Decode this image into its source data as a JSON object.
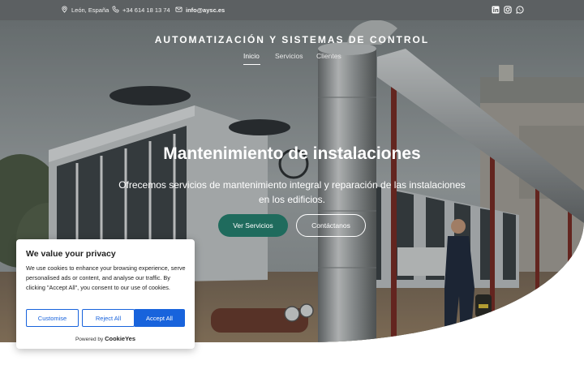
{
  "topbar": {
    "location": "León, España",
    "phone": "+34 614 18 13 74",
    "email": "info@aysc.es",
    "social": [
      "linkedin-icon",
      "instagram-icon",
      "whatsapp-icon"
    ]
  },
  "header": {
    "brand": "AUTOMATIZACIÓN Y SISTEMAS DE CONTROL",
    "nav": [
      {
        "label": "Inicio",
        "active": true
      },
      {
        "label": "Servicios",
        "active": false
      },
      {
        "label": "Clientes",
        "active": false
      }
    ]
  },
  "hero": {
    "title": "Mantenimiento de instalaciones",
    "subtitle": "Ofrecemos servicios de mantenimiento integral y reparación de las instalaciones en los edificios.",
    "primary_button": "Ver Servicios",
    "secondary_button": "Contáctanos"
  },
  "cookie": {
    "title": "We value your privacy",
    "text": "We use cookies to enhance your browsing experience, serve personalised ads or content, and analyse our traffic. By clicking \"Accept All\", you consent to our use of cookies.",
    "customise": "Customise",
    "reject": "Reject All",
    "accept": "Accept All",
    "powered_by": "Powered by",
    "brand": "CookieYes"
  },
  "colors": {
    "topbar": "#5c6062",
    "primary_button": "#1f6b5d",
    "cookie_accent": "#1863dc"
  }
}
